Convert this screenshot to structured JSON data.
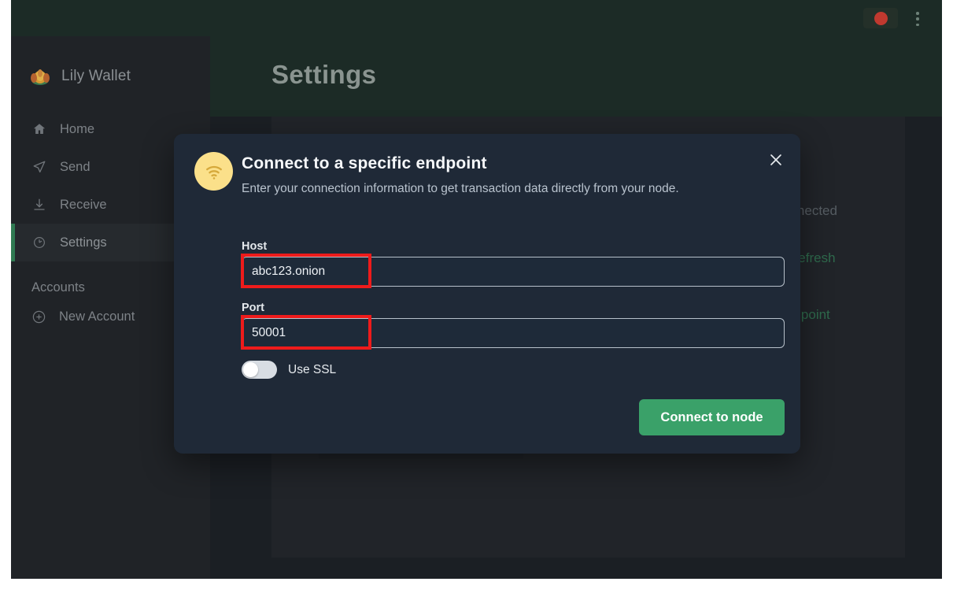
{
  "titlebar": {
    "record_indicator": "record-dot",
    "menu_icon": "kebab-menu-icon"
  },
  "sidebar": {
    "brand": "Lily Wallet",
    "items": [
      {
        "label": "Home",
        "icon": "home-icon",
        "active": false
      },
      {
        "label": "Send",
        "icon": "send-icon",
        "active": false
      },
      {
        "label": "Receive",
        "icon": "receive-icon",
        "active": false
      },
      {
        "label": "Settings",
        "icon": "settings-icon",
        "active": true
      }
    ],
    "section_label": "Accounts",
    "new_account": {
      "label": "New Account",
      "icon": "plus-circle-icon"
    }
  },
  "main": {
    "page_title": "Settings",
    "status_text": "sconnected",
    "refresh_label": "Refresh",
    "change_endpoint_label": "ange endpoint"
  },
  "modal": {
    "icon": "wifi-icon",
    "title": "Connect to a specific endpoint",
    "subtitle": "Enter your connection information to get transaction data directly from your node.",
    "close_icon": "close-icon",
    "host": {
      "label": "Host",
      "value": "abc123.onion",
      "placeholder": ""
    },
    "port": {
      "label": "Port",
      "value": "50001",
      "placeholder": ""
    },
    "ssl_toggle": {
      "label": "Use SSL",
      "state": "off"
    },
    "submit_label": "Connect to node"
  },
  "colors": {
    "accent_green": "#3aa169",
    "modal_bg": "#1f2937",
    "sidebar_bg": "#202327",
    "header_green": "#1c2b26",
    "annotation_red": "#ee1b1b",
    "icon_yellow": "#fbe08a"
  }
}
